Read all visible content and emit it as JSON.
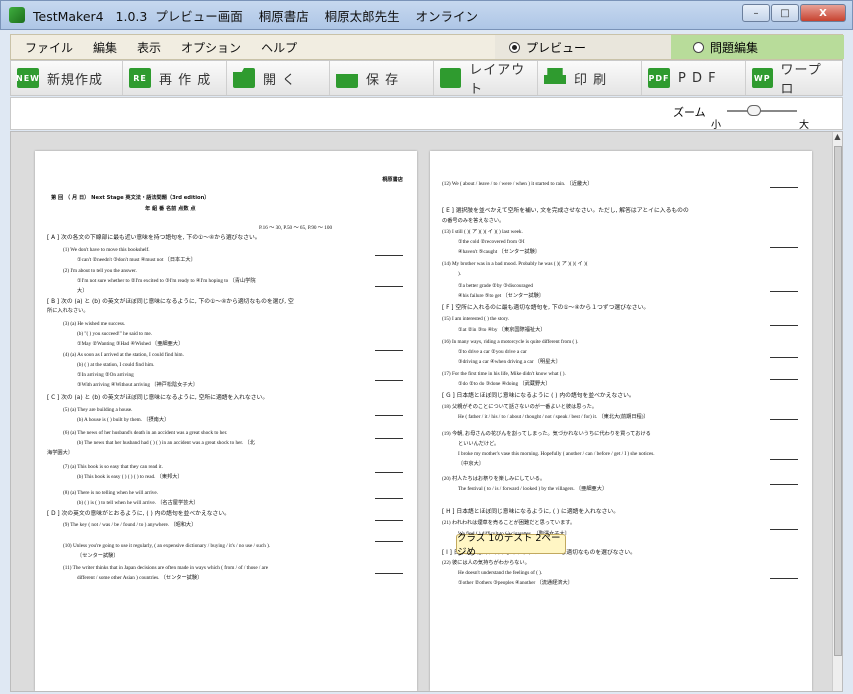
{
  "window": {
    "title": "TestMaker4   1.0.3  プレビュー画面    桐原書店    桐原太郎先生    オンライン",
    "minimize": "–",
    "maximize": "□",
    "close": "X"
  },
  "menu": [
    "ファイル",
    "編集",
    "表示",
    "オプション",
    "ヘルプ"
  ],
  "mode": {
    "preview": "プレビュー",
    "edit": "問題編集"
  },
  "toolbar": [
    {
      "icon": "NEW",
      "label": "新規作成"
    },
    {
      "icon": "RE",
      "label": "再 作 成"
    },
    {
      "icon": "",
      "label": "開  く"
    },
    {
      "icon": "",
      "label": "保  存"
    },
    {
      "icon": "",
      "label": "レイアウト"
    },
    {
      "icon": "",
      "label": "印  刷"
    },
    {
      "icon": "PDF",
      "label": "P D F"
    },
    {
      "icon": "WP",
      "label": "ワープロ"
    }
  ],
  "zoom": {
    "label": "ズーム",
    "small": "小",
    "large": "大"
  },
  "tooltip": "クラス 1のテスト 2ページめ",
  "page1": {
    "lines": [
      "桐原書店",
      "第    回   （    月    日）   Next Stage 英文法・語法問題（3rd edition）",
      "年    組    番         名前                                                    点数      点",
      "P.16 〜 30, P.50 〜 65, P.90 〜 100",
      "[ A ] 次の各文の下線部に最も近い意味を持つ語句を, 下の①〜④から選びなさい。",
      "(1)     We don't have to move this bookshelf.",
      "①can't   ②needn't   ③don't must   ④must not     〔日本工大〕",
      "(2)     I'm about to tell you the answer.",
      "①I'm not sure whether to   ②I'm excited to   ③I'm ready to   ④I'm hoping to    〔青山学院",
      "大〕",
      "[ B ] 次の (a) と (b) の英文がほぼ同じ意味になるように, 下の①〜④から適切なものを選び, 空",
      "所に入れなさい。",
      "(3)     (a) He wished me success.",
      "(b) \"(        ) you succeed!\" he said to me.",
      "①May   ②Wanting   ③Had   ④Wished     〔亜細亜大〕",
      "(4)     (a) As soon as I arrived at the station, I could find him.",
      "(b) (        ) at the station, I could find him.",
      "①In arriving   ②On arriving",
      "③With arriving   ④Without arriving     〔神戸松陰女子大〕",
      "[ C ] 次の (a) と (b) の英文がほぼ同じ意味になるように, 空所に適語を入れなさい。",
      "(5)     (a) They are building a house.",
      "(b) A house is (        ) built by them.     〔摂南大〕",
      "(6)     (a) The news of her husband's death in an accident was a great shock to her.",
      "(b) The news that her husband had (     ) (     ) in an accident was a great shock to her.    〔北",
      "海学園大〕",
      "(7)     (a) This book is so easy that they can read it.",
      "(b) This book is easy (     ) (     ) (     ) to read.     〔東邦大〕",
      "(8)     (a) There is no telling when he will arrive.",
      "(b) (     ) is (     ) to tell when he will arrive.     〔名古屋学芸大〕",
      "[ D ] 次の英文の意味がとおるように, (   ) 内の語句を並べかえなさい。",
      "(9)     The key ( not / was / be / found / to ) anywhere.     〔昭和大〕",
      "(10)   Unless you're going to use it regularly, ( an expensive dictionary / buying / it's / no use / such ).",
      "〔センター試験〕",
      "(11)   The writer thinks that in Japan decisions are often made in ways which ( from / of / those / are",
      "different / some other Asian ) countries.    〔センター試験〕"
    ]
  },
  "page2": {
    "lines": [
      "(12)   We ( about / leave / to / were / when ) it started to rain.     〔近畿大〕",
      "[ E ] 選択肢を並べかえて空所を補い, 文を完成させなさい。ただし, 解答はアとイに入るものの",
      "の番号のみを答えなさい。",
      "(13)   I still (        )(   ア   )(        )(   イ   )(        ) last week.",
      "①the cold   ②recovered from   ③I",
      "④haven't   ⑤caught     〔センター試験〕",
      "(14)   My brother was in a bad mood. Probably he was (     )(   ア   )(     )(   イ   )(",
      ").",
      "①a better grade   ②by   ③discouraged",
      "④his failure   ⑤to get     〔センター試験〕",
      "[ F ] 空所に入れるのに最も適切な語句を, 下の①〜④から１つずつ選びなさい。",
      "(15)   I am interested (     ) the story.",
      "①at   ②in   ③to   ④by     〔東京国際福祉大〕",
      "(16)   In many ways, riding a motorcycle is quite different from (        ).",
      "①to drive a car   ②you drive a car",
      "③driving a car   ④when driving a car     〔明星大〕",
      "(17)   For the first time in his life, Mike didn't know what (        ).",
      "①do   ②to do   ③done   ④doing     〔武蔵野大〕",
      "[ G ] 日本語とほぼ同じ意味になるように ( ) 内の語句を並べかえなさい。",
      "(18)   父親がそのことについて話さないのが一番よいと彼は思った。",
      "He ( father / it / his / to / about / thought / not / speak / best / for) it.     〔東北大(前期日程)〕",
      "(19)   今朝, お母さんの花びんを割ってしまった。気づかれないうちに代わりを買っておける",
      "といいんだけど。",
      "I broke my mother's vase this morning. Hopefully ( another / can / before / get / I ) she notices.",
      "〔中京大〕",
      "(20)   村人たちはお祭りを楽しみにしている。",
      "The festival ( to / is / forward / looked ) by the villagers.     〔亜細亜大〕",
      "[ H ] 日本語とほぼ同じ意味になるように, (   ) に適語を入れなさい。",
      "(21)   われわれは煙草を売ることが困難だと思っています。",
      "We find (        ) difficult to (        ) cigarettes.     〔駒澤女子大〕",
      "[ I ] 日本語の意味に合うように, 下の①〜④から適切なものを選びなさい。",
      "(22)   彼には人の気持ちがわからない。",
      "He doesn't understand the feelings of (        ).",
      "①other   ②others   ③peoples   ④another     〔流通経済大〕"
    ]
  }
}
